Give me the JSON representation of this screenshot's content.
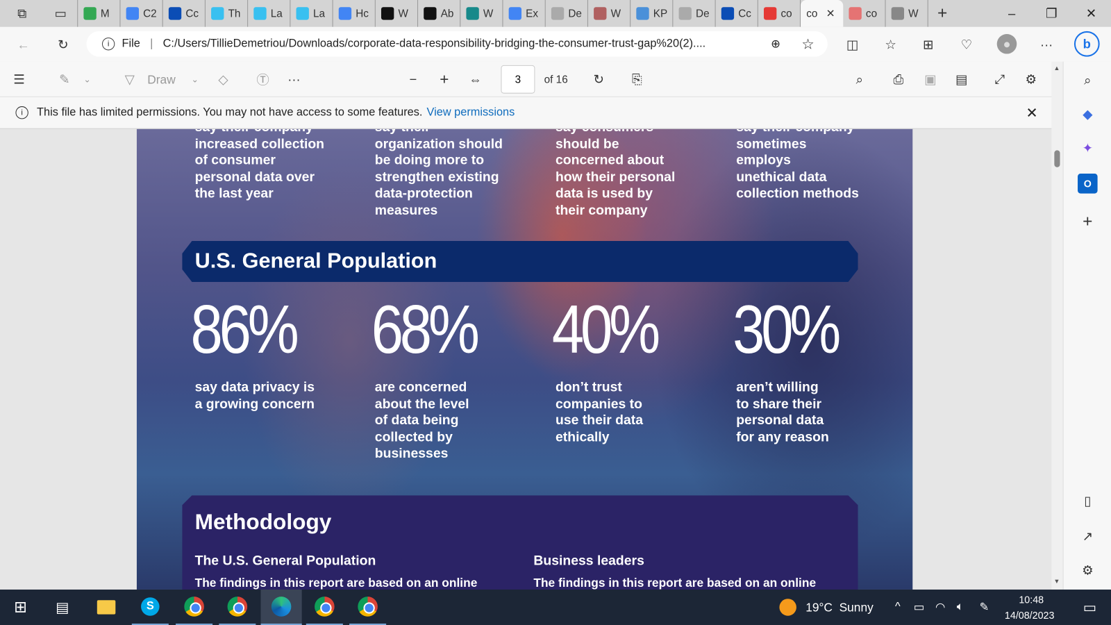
{
  "browser": {
    "tabs": [
      {
        "label": "M",
        "color": "#34a853"
      },
      {
        "label": "C2",
        "color": "#4285f4"
      },
      {
        "label": "Cc",
        "color": "#0b4db5"
      },
      {
        "label": "Th",
        "color": "#39c0f0"
      },
      {
        "label": "La",
        "color": "#39c0f0"
      },
      {
        "label": "La",
        "color": "#39c0f0"
      },
      {
        "label": "Hc",
        "color": "#4285f4"
      },
      {
        "label": "W",
        "color": "#111111"
      },
      {
        "label": "Ab",
        "color": "#111111"
      },
      {
        "label": "W",
        "color": "#17898a"
      },
      {
        "label": "Ex",
        "color": "#4285f4"
      },
      {
        "label": "De",
        "color": "#aaaaaa"
      },
      {
        "label": "W",
        "color": "#b06060"
      },
      {
        "label": "KP",
        "color": "#4a90d9"
      },
      {
        "label": "De",
        "color": "#aaaaaa"
      },
      {
        "label": "Cc",
        "color": "#0b4db5"
      },
      {
        "label": "co",
        "color": "#e53935"
      },
      {
        "label": "co",
        "color": "#ffffff",
        "active": true
      },
      {
        "label": "co",
        "color": "#e57373"
      },
      {
        "label": "W",
        "color": "#888888"
      }
    ],
    "address": {
      "scheme": "File",
      "url": "C:/Users/TillieDemetriou/Downloads/corporate-data-responsibility-bridging-the-consumer-trust-gap%20(2)...."
    }
  },
  "pdf_toolbar": {
    "draw_label": "Draw",
    "page_current": "3",
    "page_total": "of 16"
  },
  "infobar": {
    "message": "This file has limited permissions. You may not have access to some features.",
    "link": "View permissions"
  },
  "document": {
    "top_stats": [
      "say their company\nincreased collection\nof consumer\npersonal data over\nthe last year",
      "say their\norganization should\nbe doing more to\nstrengthen existing\ndata-protection\nmeasures",
      "say consumers\nshould be\nconcerned about\nhow their personal\ndata is used by\ntheir company",
      "say their company\nsometimes\nemploys\nunethical data\ncollection methods"
    ],
    "section_title": "U.S. General Population",
    "stats": [
      {
        "value": "86%",
        "text": "say data privacy is\na growing concern"
      },
      {
        "value": "68%",
        "text": "are concerned\nabout the level\nof data being\ncollected by\nbusinesses"
      },
      {
        "value": "40%",
        "text": "don’t trust\ncompanies to\nuse their data\nethically"
      },
      {
        "value": "30%",
        "text": "aren’t willing\nto share their\npersonal data\nfor any reason"
      }
    ],
    "methodology": {
      "title": "Methodology",
      "columns": [
        {
          "heading": "The U.S. General Population",
          "text": "The findings in this report are based on an online"
        },
        {
          "heading": "Business leaders",
          "text": "The findings in this report are based on an online"
        }
      ]
    }
  },
  "taskbar": {
    "weather": "19°C  Sunny",
    "time": "10:48",
    "date": "14/08/2023"
  }
}
